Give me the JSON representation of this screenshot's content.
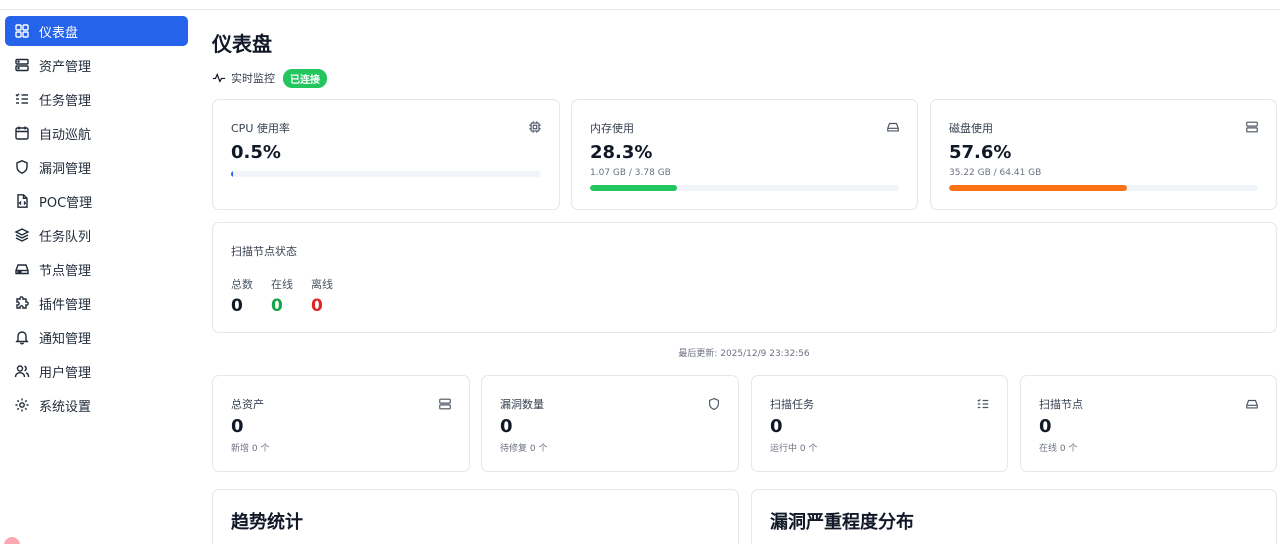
{
  "sidebar": {
    "items": [
      {
        "label": "仪表盘",
        "icon": "grid-icon",
        "active": true
      },
      {
        "label": "资产管理",
        "icon": "server-icon"
      },
      {
        "label": "任务管理",
        "icon": "list-check-icon"
      },
      {
        "label": "自动巡航",
        "icon": "calendar-icon"
      },
      {
        "label": "漏洞管理",
        "icon": "shield-icon"
      },
      {
        "label": "POC管理",
        "icon": "file-code-icon"
      },
      {
        "label": "任务队列",
        "icon": "layers-icon"
      },
      {
        "label": "节点管理",
        "icon": "hard-drive-icon"
      },
      {
        "label": "插件管理",
        "icon": "puzzle-icon"
      },
      {
        "label": "通知管理",
        "icon": "bell-icon"
      },
      {
        "label": "用户管理",
        "icon": "users-icon"
      },
      {
        "label": "系统设置",
        "icon": "gear-icon"
      }
    ]
  },
  "main": {
    "title": "仪表盘",
    "monitor": {
      "label": "实时监控",
      "badge": "已连接"
    },
    "resources": {
      "cpu": {
        "title": "CPU 使用率",
        "value": "0.5%",
        "percent": 0.5
      },
      "memory": {
        "title": "内存使用",
        "value": "28.3%",
        "detail": "1.07 GB / 3.78 GB",
        "percent": 28.3
      },
      "disk": {
        "title": "磁盘使用",
        "value": "57.6%",
        "detail": "35.22 GB / 64.41 GB",
        "percent": 57.6
      }
    },
    "node_status": {
      "title": "扫描节点状态",
      "total": {
        "label": "总数",
        "value": "0"
      },
      "online": {
        "label": "在线",
        "value": "0"
      },
      "offline": {
        "label": "离线",
        "value": "0"
      }
    },
    "last_updated": "最后更新: 2025/12/9 23:32:56",
    "stats": [
      {
        "title": "总资产",
        "value": "0",
        "sub": "新增 0 个",
        "icon": "server-icon"
      },
      {
        "title": "漏洞数量",
        "value": "0",
        "sub": "待修复 0 个",
        "icon": "shield-icon"
      },
      {
        "title": "扫描任务",
        "value": "0",
        "sub": "运行中 0 个",
        "icon": "list-check-icon"
      },
      {
        "title": "扫描节点",
        "value": "0",
        "sub": "在线 0 个",
        "icon": "hard-drive-icon"
      }
    ],
    "sections": {
      "trend": "趋势统计",
      "severity": "漏洞严重程度分布"
    }
  },
  "colors": {
    "accent": "#2563eb",
    "success": "#22c55e",
    "memory_bar": "#22c55e",
    "disk_bar": "#f97316",
    "online": "#16a34a",
    "offline": "#dc2626"
  }
}
